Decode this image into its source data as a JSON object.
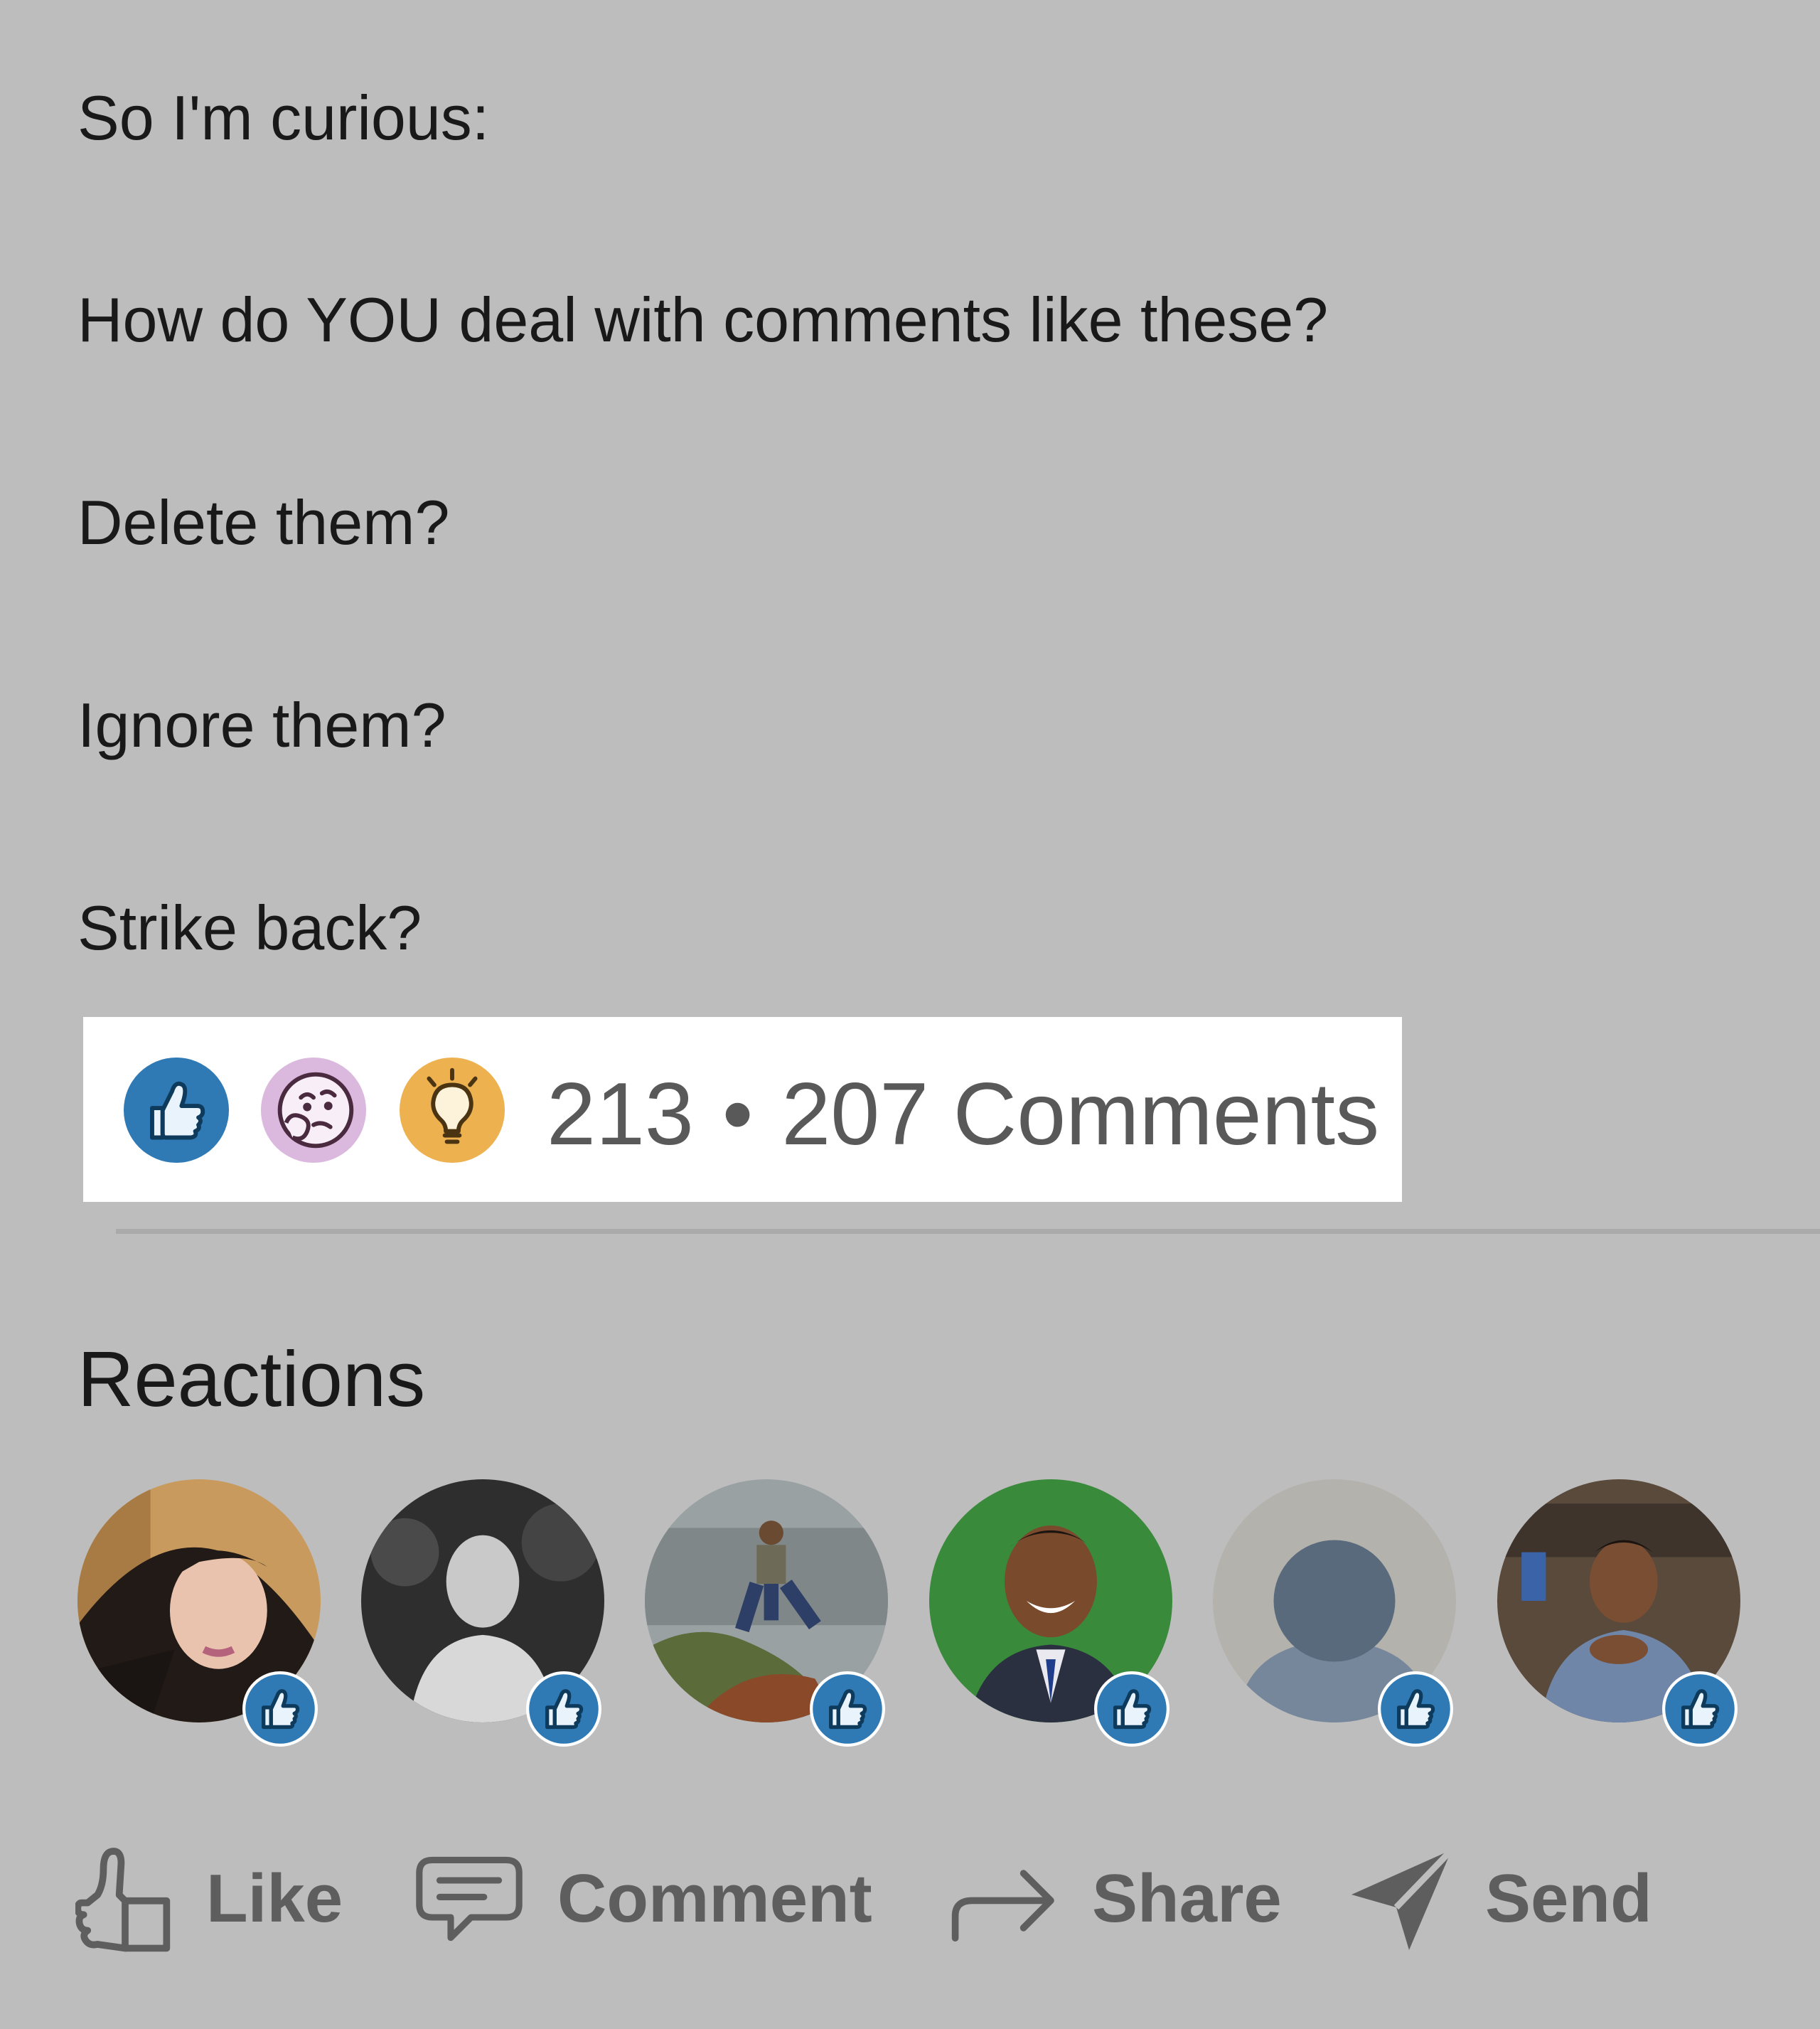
{
  "post": {
    "lines": [
      "So I'm curious:",
      "How do YOU deal with comments like these?",
      "Delete them?",
      "Ignore them?",
      "Strike back?"
    ]
  },
  "social_counts": {
    "reaction_icons": [
      "like-icon",
      "curious-icon",
      "insightful-icon"
    ],
    "reactions_count": "213",
    "separator": "•",
    "comments_count": "207 Comments"
  },
  "reactions": {
    "title": "Reactions",
    "avatars": [
      {
        "avatar": "user-avatar-woman",
        "badge": "like-icon"
      },
      {
        "avatar": "user-avatar-man-grayscale",
        "badge": "like-icon"
      },
      {
        "avatar": "user-avatar-man-seaside",
        "badge": "like-icon"
      },
      {
        "avatar": "user-avatar-man-green-bg",
        "badge": "like-icon"
      },
      {
        "avatar": "user-avatar-placeholder",
        "badge": "like-icon"
      },
      {
        "avatar": "user-avatar-man-office",
        "badge": "like-icon"
      }
    ]
  },
  "actions": {
    "like": "Like",
    "comment": "Comment",
    "share": "Share",
    "send": "Send"
  },
  "colors": {
    "background": "#bdbdbd",
    "like_blue": "#2f7ab5",
    "curious_purple": "#dbb8dd",
    "insight_orange": "#edb14f",
    "action_gray": "#5e5e5e"
  }
}
